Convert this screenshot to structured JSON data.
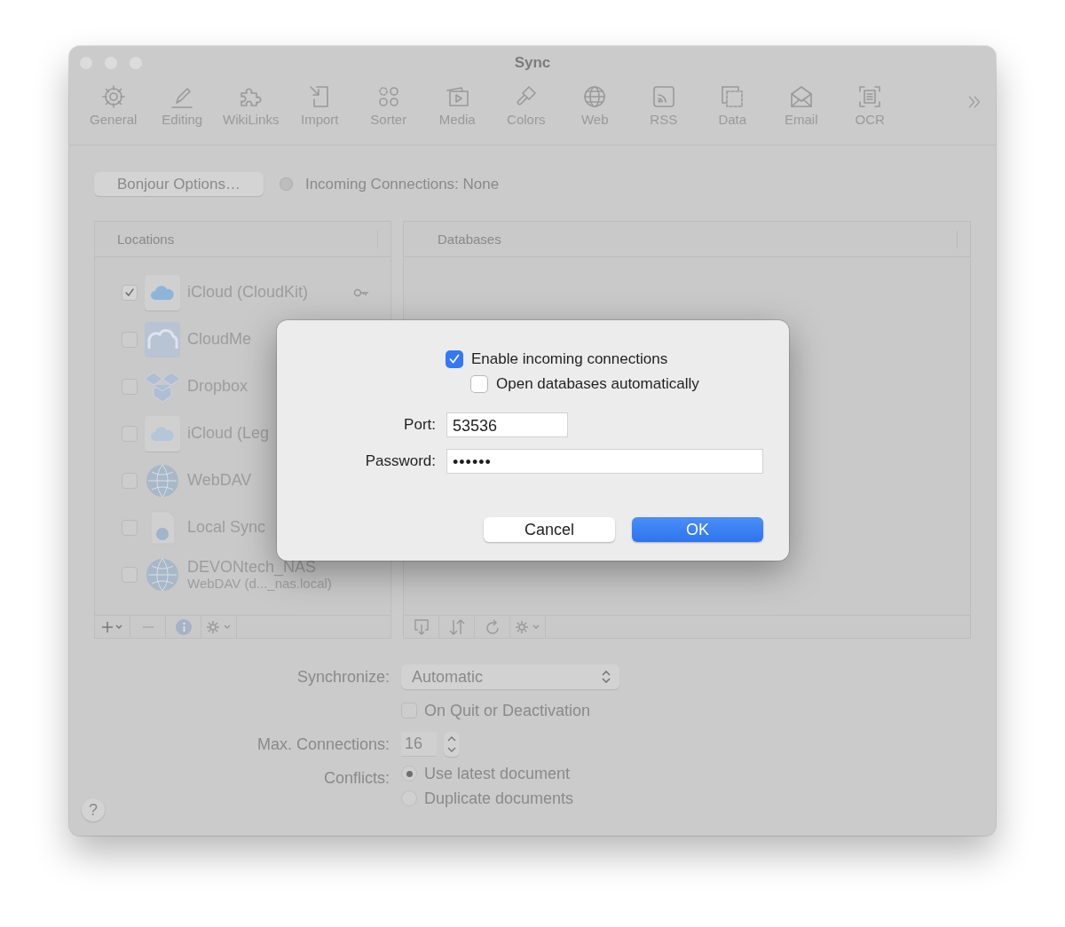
{
  "window": {
    "title": "Sync"
  },
  "toolbar": {
    "items": [
      {
        "label": "General"
      },
      {
        "label": "Editing"
      },
      {
        "label": "WikiLinks"
      },
      {
        "label": "Import"
      },
      {
        "label": "Sorter"
      },
      {
        "label": "Media"
      },
      {
        "label": "Colors"
      },
      {
        "label": "Web"
      },
      {
        "label": "RSS"
      },
      {
        "label": "Data"
      },
      {
        "label": "Email"
      },
      {
        "label": "OCR"
      }
    ]
  },
  "bonjour": {
    "button": "Bonjour Options…",
    "status": "Incoming Connections: None"
  },
  "locations": {
    "header": "Locations",
    "items": [
      {
        "name": "iCloud (CloudKit)",
        "checked": true
      },
      {
        "name": "CloudMe",
        "checked": false
      },
      {
        "name": "Dropbox",
        "checked": false
      },
      {
        "name": "iCloud (Leg",
        "checked": false
      },
      {
        "name": "WebDAV",
        "checked": false
      },
      {
        "name": "Local Sync",
        "checked": false
      },
      {
        "name": "DEVONtech_NAS",
        "subtitle": "WebDAV (d..._nas.local)",
        "checked": false
      }
    ]
  },
  "databases": {
    "header": "Databases"
  },
  "settings": {
    "synchronize_label": "Synchronize:",
    "synchronize_value": "Automatic",
    "on_quit": {
      "label": "On Quit or Deactivation",
      "checked": false
    },
    "max_connections_label": "Max. Connections:",
    "max_connections": "16",
    "conflicts_label": "Conflicts:",
    "conflict_options": [
      {
        "label": "Use latest document",
        "selected": true
      },
      {
        "label": "Duplicate documents",
        "selected": false
      }
    ]
  },
  "help": "?",
  "dialog": {
    "options": [
      {
        "label": "Enable incoming connections",
        "checked": true
      },
      {
        "label": "Open databases automatically",
        "checked": false
      }
    ],
    "port_label": "Port:",
    "port": "53536",
    "password_label": "Password:",
    "password": "••••••",
    "buttons": [
      {
        "label": "Cancel",
        "default": false
      },
      {
        "label": "OK",
        "default": true
      }
    ]
  }
}
